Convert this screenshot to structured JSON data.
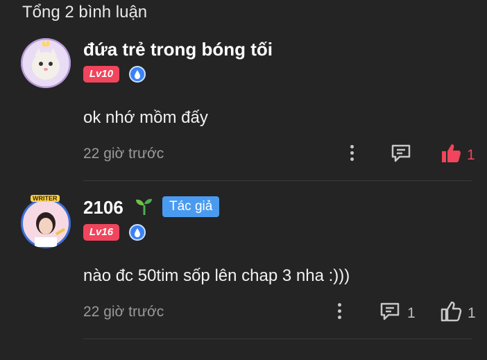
{
  "header": {
    "title": "Tổng 2 bình luận"
  },
  "comments": [
    {
      "username": "đứa trẻ trong bóng tối",
      "level": "Lv10",
      "text": "ok nhớ mồm đấy",
      "time": "22 giờ trước",
      "like_count": "1",
      "liked": true
    },
    {
      "username": "2106",
      "author_tag": "Tác giả",
      "level": "Lv16",
      "avatar_frame_text": "WRITER",
      "text": "nào đc 50tim sốp lên chap 3  nha :)))",
      "time": "22 giờ trước",
      "reply_count": "1",
      "like_count": "1",
      "liked": false
    }
  ],
  "colors": {
    "background": "#242424",
    "level_badge": "#f0455c",
    "liked": "#f0455c",
    "author_tag": "#4a9bf0"
  }
}
